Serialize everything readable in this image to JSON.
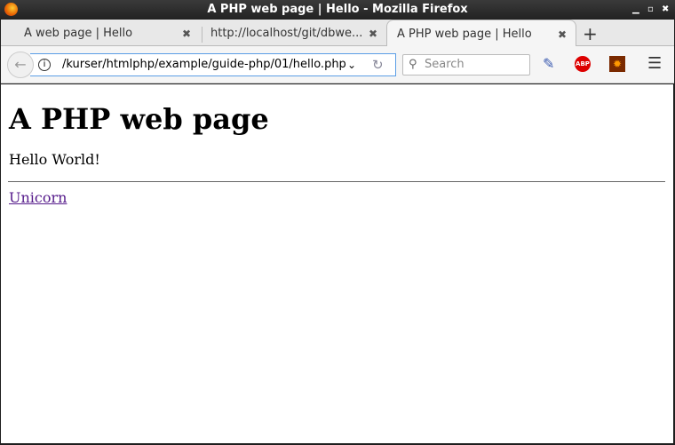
{
  "window": {
    "title": "A PHP web page | Hello - Mozilla Firefox"
  },
  "tabs": [
    {
      "label": "A web page | Hello"
    },
    {
      "label": "http://localhost/git/dbwe..."
    },
    {
      "label": "A PHP web page | Hello"
    }
  ],
  "navbar": {
    "url": "/kurser/htmlphp/example/guide-php/01/hello.php",
    "search_placeholder": "Search",
    "abp_label": "ABP"
  },
  "page": {
    "heading": "A PHP web page",
    "paragraph": "Hello World!",
    "link": "Unicorn"
  }
}
